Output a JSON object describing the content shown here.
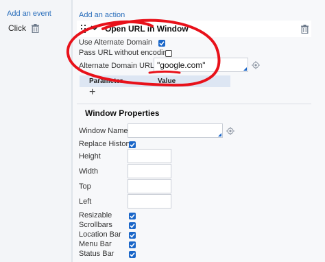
{
  "events": {
    "add_label": "Add an event",
    "items": [
      {
        "label": "Click"
      }
    ]
  },
  "action": {
    "add_label": "Add an action",
    "title": "Open URL in Window",
    "use_alternate_domain": {
      "label": "Use Alternate Domain",
      "checked": true
    },
    "pass_url_without_encoding": {
      "label": "Pass URL without encoding",
      "checked": false
    },
    "alternate_domain_url": {
      "label": "Alternate Domain URL",
      "required_mark": "*",
      "value": "\"google.com\""
    },
    "parameter_table": {
      "columns": [
        "Parameter",
        "Value"
      ],
      "add_symbol": "+"
    }
  },
  "window_properties": {
    "title": "Window Properties",
    "window_name": {
      "label": "Window Name",
      "value": ""
    },
    "replace_history": {
      "label": "Replace History",
      "checked": true
    },
    "height": {
      "label": "Height",
      "value": ""
    },
    "width": {
      "label": "Width",
      "value": ""
    },
    "top": {
      "label": "Top",
      "value": ""
    },
    "left": {
      "label": "Left",
      "value": ""
    },
    "resizable": {
      "label": "Resizable",
      "checked": true
    },
    "scrollbars": {
      "label": "Scrollbars",
      "checked": true
    },
    "location_bar": {
      "label": "Location Bar",
      "checked": true
    },
    "menu_bar": {
      "label": "Menu Bar",
      "checked": true
    },
    "status_bar": {
      "label": "Status Bar",
      "checked": true
    }
  },
  "colors": {
    "link": "#2a6ebb",
    "checkbox": "#1a66c8",
    "annotation": "#e8111a",
    "required": "#e08a00"
  }
}
